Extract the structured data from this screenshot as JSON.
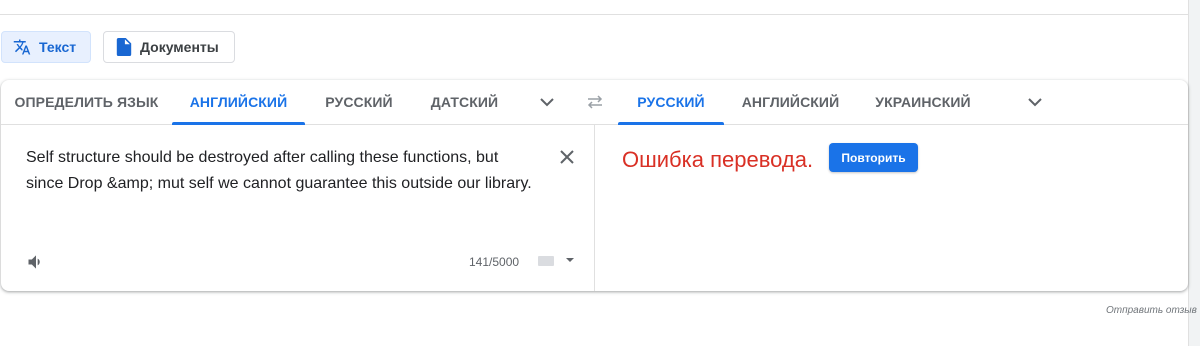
{
  "modes": {
    "text_label": "Текст",
    "docs_label": "Документы"
  },
  "source_tabs": [
    "ОПРЕДЕЛИТЬ ЯЗЫК",
    "АНГЛИЙСКИЙ",
    "РУССКИЙ",
    "ДАТСКИЙ"
  ],
  "target_tabs": [
    "РУССКИЙ",
    "АНГЛИЙСКИЙ",
    "УКРАИНСКИЙ"
  ],
  "source": {
    "text": "Self structure should be destroyed after calling these functions, but since Drop &amp; mut self we cannot guarantee this outside our library.",
    "counter": "141/5000"
  },
  "target": {
    "error": "Ошибка перевода.",
    "retry_label": "Повторить"
  },
  "feedback_label": "Отправить отзыв",
  "colors": {
    "accent": "#1a73e8",
    "error": "#d93025"
  },
  "icons": [
    "translate-icon",
    "document-icon",
    "chevron-down-icon",
    "swap-icon",
    "close-icon",
    "speaker-icon",
    "keyboard-icon"
  ]
}
